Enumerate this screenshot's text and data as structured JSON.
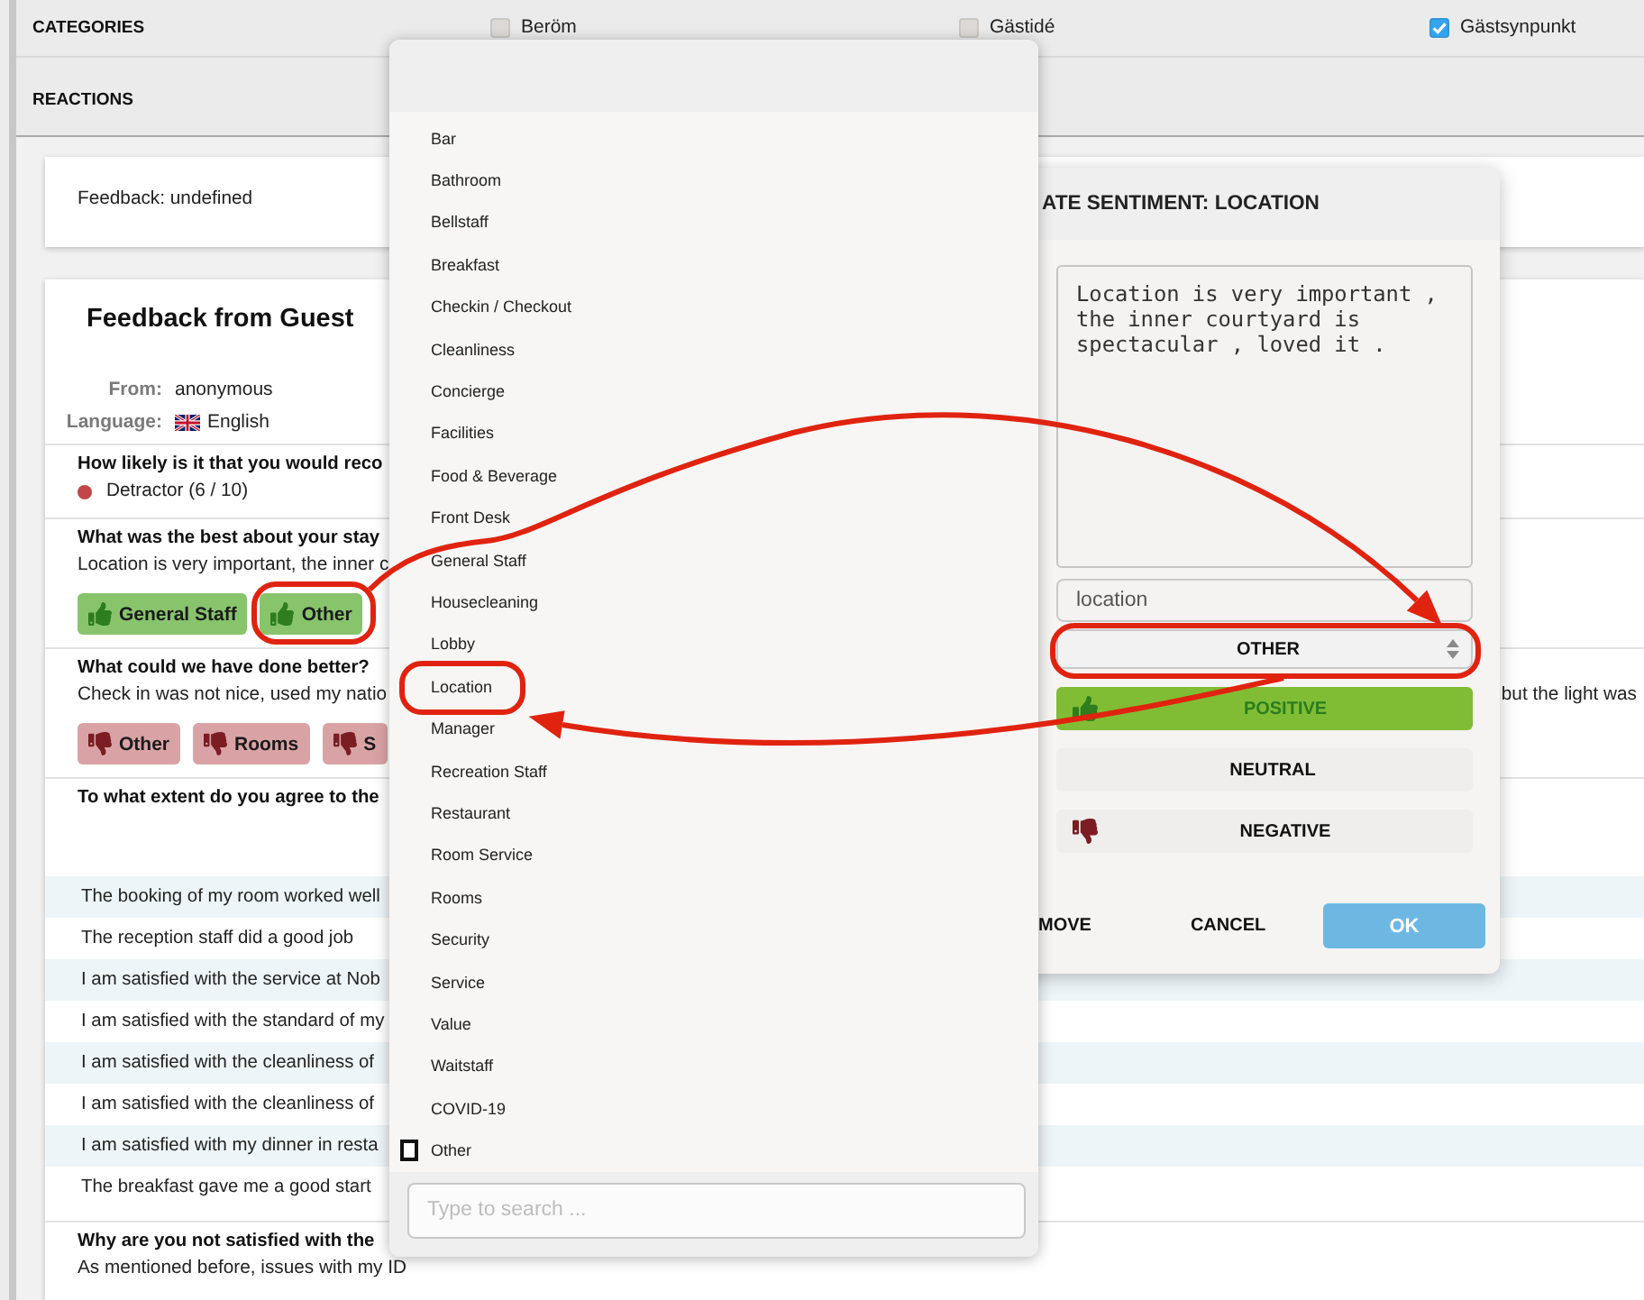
{
  "header": {
    "categories": {
      "label": "CATEGORIES",
      "options": [
        {
          "label": "Beröm",
          "checked": false
        },
        {
          "label": "Gästidé",
          "checked": false
        },
        {
          "label": "Gästsynpunkt",
          "checked": true
        }
      ]
    },
    "reactions": {
      "label": "REACTIONS"
    }
  },
  "note": {
    "text": "Feedback: undefined"
  },
  "feedback": {
    "title": "Feedback from Guest",
    "meta": [
      {
        "label": "From:",
        "value": "anonymous",
        "kind": "text"
      },
      {
        "label": "Language:",
        "value": "English",
        "kind": "language"
      }
    ],
    "questions": [
      {
        "kind": "score",
        "question": "How likely is it that you would reco",
        "answer": "Detractor (6 / 10)",
        "color": "#c0474b"
      },
      {
        "kind": "text",
        "question": "What was the best about your stay",
        "answer": "Location is very important, the inner c",
        "tags": [
          {
            "label": "General Staff",
            "kind": "positive"
          },
          {
            "label": "Other",
            "kind": "positive"
          }
        ]
      },
      {
        "kind": "text",
        "question": "What could we have done better?",
        "answer": "Check in was not nice, used my natio",
        "answer_tail": "but the light was",
        "tags": [
          {
            "label": "Other",
            "kind": "negative"
          },
          {
            "label": "Rooms",
            "kind": "negative"
          },
          {
            "label": "S",
            "kind": "negative"
          }
        ]
      },
      {
        "kind": "statements",
        "question": "To what extent do you agree to the",
        "statements": [
          "The booking of my room worked well",
          "The reception staff did a good job",
          "I am satisfied with the service at Nob",
          "I am satisfied with the standard of my",
          "I am satisfied with the cleanliness of",
          "I am satisfied with the cleanliness of",
          "I am satisfied with my dinner in resta",
          "The breakfast gave me a good start"
        ]
      },
      {
        "kind": "text",
        "question": "Why are you not satisfied with the",
        "answer": "As mentioned before, issues with my ID"
      }
    ]
  },
  "category_menu": {
    "items": [
      {
        "label": "Bar",
        "kind": "option"
      },
      {
        "label": "Bathroom",
        "kind": "option"
      },
      {
        "label": "Bellstaff",
        "kind": "option"
      },
      {
        "label": "Breakfast",
        "kind": "option"
      },
      {
        "label": "Checkin / Checkout",
        "kind": "option"
      },
      {
        "label": "Cleanliness",
        "kind": "option"
      },
      {
        "label": "Concierge",
        "kind": "option"
      },
      {
        "label": "Facilities",
        "kind": "option"
      },
      {
        "label": "Food & Beverage",
        "kind": "option"
      },
      {
        "label": "Front Desk",
        "kind": "option"
      },
      {
        "label": "General Staff",
        "kind": "option"
      },
      {
        "label": "Housecleaning",
        "kind": "option"
      },
      {
        "label": "Lobby",
        "kind": "option"
      },
      {
        "label": "Location",
        "kind": "option"
      },
      {
        "label": "Manager",
        "kind": "option"
      },
      {
        "label": "Recreation Staff",
        "kind": "option"
      },
      {
        "label": "Restaurant",
        "kind": "option"
      },
      {
        "label": "Room Service",
        "kind": "option"
      },
      {
        "label": "Rooms",
        "kind": "option"
      },
      {
        "label": "Security",
        "kind": "option"
      },
      {
        "label": "Service",
        "kind": "option"
      },
      {
        "label": "Value",
        "kind": "option"
      },
      {
        "label": "Waitstaff",
        "kind": "option"
      },
      {
        "label": "COVID-19",
        "kind": "option"
      },
      {
        "label": "Other",
        "kind": "checkbox",
        "checked": false
      }
    ],
    "search": {
      "placeholder": "Type to search ..."
    }
  },
  "sentiment_dialog": {
    "title": "ATE SENTIMENT: LOCATION",
    "comment": "Location is very important , the inner courtyard is spectacular , loved it .",
    "keyword": "location",
    "category": "OTHER",
    "sentiments": [
      {
        "label": "POSITIVE",
        "kind": "positive",
        "selected": true
      },
      {
        "label": "NEUTRAL",
        "kind": "neutral",
        "selected": false
      },
      {
        "label": "NEGATIVE",
        "kind": "negative",
        "selected": false
      }
    ],
    "actions": [
      {
        "label": "MOVE",
        "kind": "text"
      },
      {
        "label": "CANCEL",
        "kind": "text"
      },
      {
        "label": "OK",
        "kind": "primary"
      }
    ]
  }
}
